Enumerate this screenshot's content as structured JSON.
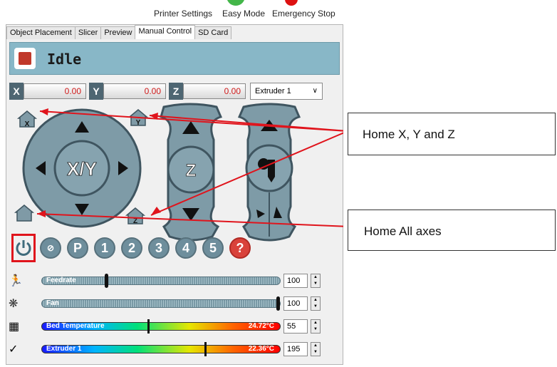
{
  "toolbar": {
    "printer_settings": "Printer Settings",
    "easy_mode": "Easy Mode",
    "emergency_stop": "Emergency Stop"
  },
  "tabs": [
    {
      "label": "Object Placement",
      "active": false
    },
    {
      "label": "Slicer",
      "active": false
    },
    {
      "label": "Preview",
      "active": false
    },
    {
      "label": "Manual Control",
      "active": true
    },
    {
      "label": "SD Card",
      "active": false
    }
  ],
  "status": {
    "text": "Idle"
  },
  "coords": {
    "x_label": "X",
    "x_value": "0.00",
    "y_label": "Y",
    "y_value": "0.00",
    "z_label": "Z",
    "z_value": "0.00",
    "extruder_selected": "Extruder 1"
  },
  "jog": {
    "xy_label": "X/Y",
    "z_label": "Z",
    "home_x_letter": "X",
    "home_y_letter": "Y",
    "home_z_letter": "Z"
  },
  "icon_row": {
    "p_label": "P",
    "nums": [
      "1",
      "2",
      "3",
      "4",
      "5"
    ],
    "help_label": "?"
  },
  "sliders": {
    "feedrate": {
      "label": "Feedrate",
      "value": "100",
      "fraction": 0.27
    },
    "fan": {
      "label": "Fan",
      "value": "100",
      "fraction": 1.0
    },
    "bed": {
      "label": "Bed Temperature",
      "reading": "24.72°C",
      "value": "55",
      "fraction": 0.45
    },
    "extruder": {
      "label": "Extruder 1",
      "reading": "22.36°C",
      "value": "195",
      "fraction": 0.69
    }
  },
  "callouts": {
    "home_xyz": "Home X, Y and Z",
    "home_all": "Home All axes"
  },
  "colors": {
    "status_bar": "#88b7c7",
    "button_gray": "#6e8e9c",
    "annotation_red": "#e0141c"
  }
}
